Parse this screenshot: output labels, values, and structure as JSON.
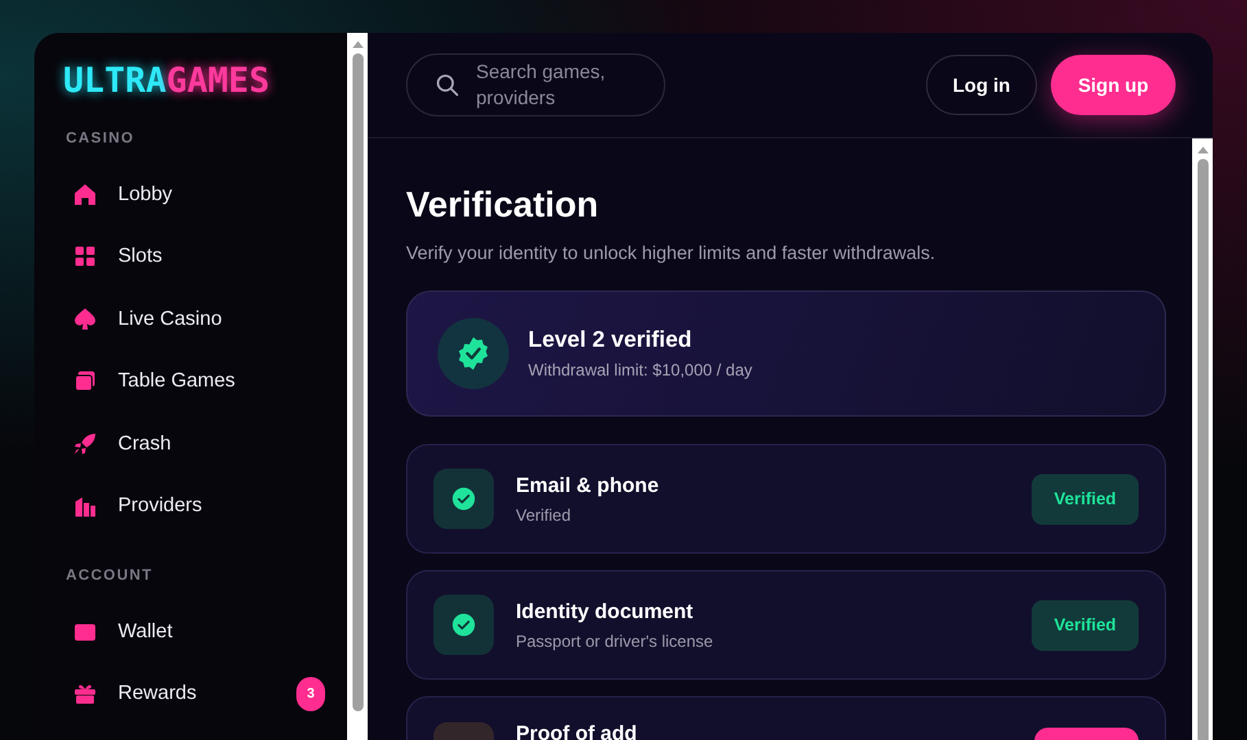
{
  "logo": {
    "part_1": "ULTRA",
    "part_2": "GAMES"
  },
  "sidebar": {
    "sections": [
      {
        "title": "CASINO",
        "items": [
          {
            "label": "Lobby"
          },
          {
            "label": "Slots"
          },
          {
            "label": "Live Casino"
          },
          {
            "label": "Table Games"
          },
          {
            "label": "Crash"
          },
          {
            "label": "Providers"
          }
        ]
      },
      {
        "title": "ACCOUNT",
        "items": [
          {
            "label": "Wallet"
          },
          {
            "label": "Rewards",
            "badge": "3"
          }
        ]
      }
    ]
  },
  "header": {
    "search": {
      "placeholder": "Search games, providers"
    },
    "buttons": [
      {
        "label": "Log in",
        "kind": "outline"
      },
      {
        "label": "Sign up",
        "kind": "primary"
      }
    ]
  },
  "page": {
    "title": "Verification",
    "subtitle": "Verify your identity to unlock higher limits and faster withdrawals.",
    "level_card": {
      "title": "Level 2 verified",
      "subtitle": "Withdrawal limit: $10,000 / day"
    },
    "steps": [
      {
        "title": "Email & phone",
        "subtitle": "Verified",
        "kind": "verified",
        "status": "Verified"
      },
      {
        "title": "Identity document",
        "subtitle": "Passport or driver's license",
        "kind": "verified",
        "status": "Verified"
      },
      {
        "title": "Proof of add",
        "kind": "pending"
      }
    ]
  }
}
